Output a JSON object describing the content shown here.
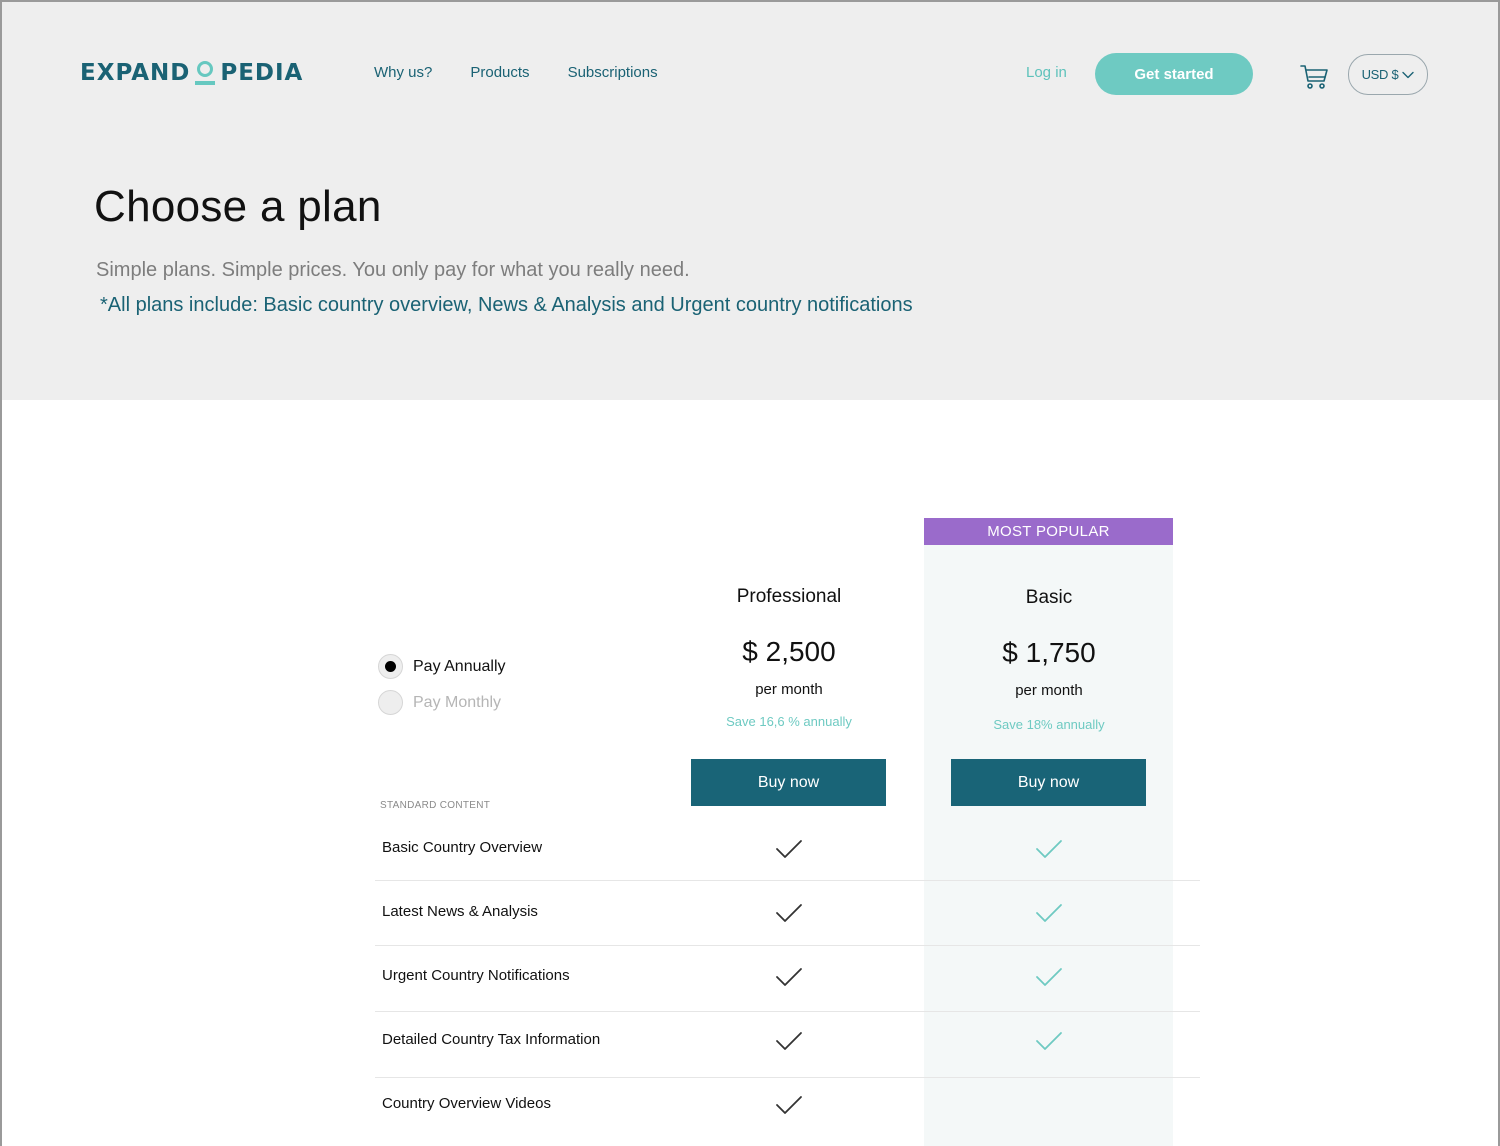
{
  "header": {
    "logo_left": "EXPAND",
    "logo_right": "PEDIA",
    "nav": [
      {
        "label": "Why us?"
      },
      {
        "label": "Products"
      },
      {
        "label": "Subscriptions"
      }
    ],
    "login_label": "Log in",
    "get_started_label": "Get started",
    "currency_label": "USD $"
  },
  "hero": {
    "title": "Choose a plan",
    "subtitle": "Simple plans. Simple prices. You only pay for what you really need.",
    "includes": "*All plans include: Basic country overview, News & Analysis and Urgent country notifications"
  },
  "billing": {
    "options": [
      {
        "label": "Pay Annually",
        "selected": true
      },
      {
        "label": "Pay Monthly",
        "selected": false
      }
    ]
  },
  "plans": [
    {
      "name": "Professional",
      "price": "$ 2,500",
      "period": "per month",
      "save": "Save 16,6 % annually",
      "button": "Buy now"
    },
    {
      "name": "Basic",
      "price": "$ 1,750",
      "period": "per month",
      "save": "Save 18% annually",
      "button": "Buy now",
      "badge": "MOST POPULAR"
    }
  ],
  "features": {
    "section_label": "STANDARD CONTENT",
    "rows": [
      {
        "name": "Basic Country Overview",
        "professional": true,
        "basic": true
      },
      {
        "name": "Latest News & Analysis",
        "professional": true,
        "basic": true
      },
      {
        "name": "Urgent Country Notifications",
        "professional": true,
        "basic": true
      },
      {
        "name": "Detailed Country Tax Information",
        "professional": true,
        "basic": true
      },
      {
        "name": "Country Overview Videos",
        "professional": true,
        "basic": false
      }
    ]
  },
  "colors": {
    "brand": "#1a6274",
    "accent": "#6ecac2",
    "badge": "#9a6bcb",
    "button": "#196477"
  },
  "icons": {
    "cart": "cart-icon",
    "chevron": "chevron-down-icon",
    "check": "check-icon"
  }
}
